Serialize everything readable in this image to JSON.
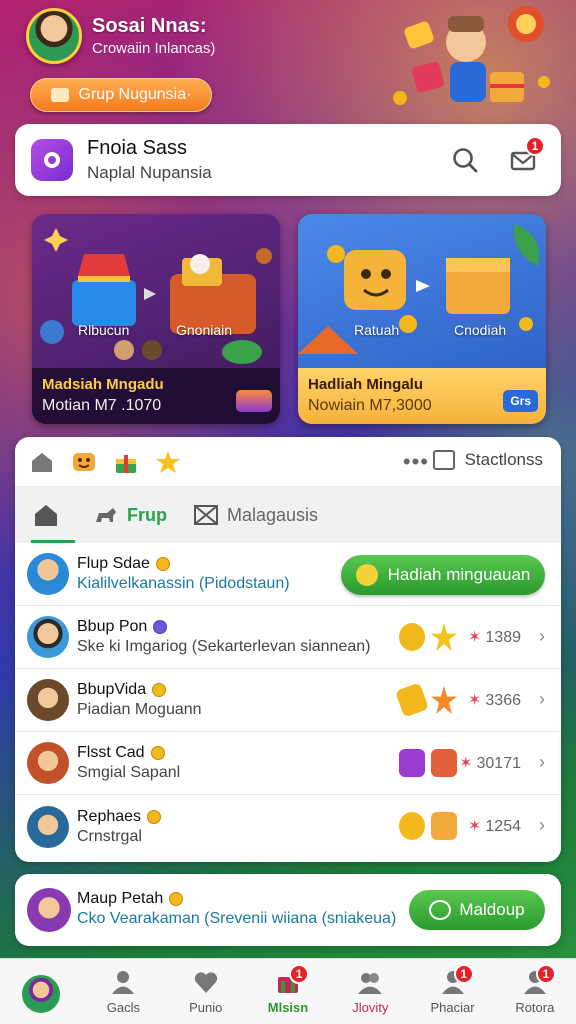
{
  "profile": {
    "name": "Sosai Nnas:",
    "subtitle": "Crowaiin Inlancas)",
    "group_button": "Grup Nugunsia·"
  },
  "search_card": {
    "title": "Fnoia Sass",
    "subtitle": "Naplal Nupansia",
    "mail_badge": "1"
  },
  "promos": [
    {
      "caption_left": "Rlbucun",
      "caption_right": "Gnoniain",
      "title": "Madsiah Mngadu",
      "amount": "Motian M7 .1070",
      "button": ""
    },
    {
      "caption_left": "Ratuah",
      "caption_right": "Cnodiah",
      "title": "Hadliah Mingalu",
      "amount": "Nowiain M7,3000",
      "button": "Grs"
    }
  ],
  "toolbar": {
    "dots": "•••",
    "sections_label": "Stactlonss"
  },
  "tabs": [
    {
      "label": "Frup",
      "active": true
    },
    {
      "label": "Malagausis",
      "active": false
    }
  ],
  "rows": [
    {
      "name": "Flup Sdae",
      "sub": "Kialilvelkanassin (Pidodstaun)",
      "button": "Hadiah minguauan"
    },
    {
      "name": "Bbup Pon",
      "sub": "Ske ki Imgariog (Sekarterlevan siannean)",
      "count": "1389"
    },
    {
      "name": "BbupVida",
      "sub": "Piadian Moguann",
      "count": "3366"
    },
    {
      "name": "Flsst Cad",
      "sub": "Smgial Sapanl",
      "count": "30171"
    },
    {
      "name": "Rephaes",
      "sub": "Crnstrgal",
      "count": "1254"
    }
  ],
  "footer_card": {
    "name": "Maup Petah",
    "sub": "Cko Vearakaman (Srevenii wiiana (sniakeua)",
    "button": "Maldoup"
  },
  "nav": [
    {
      "label": "",
      "badge": ""
    },
    {
      "label": "Gacls",
      "badge": ""
    },
    {
      "label": "Punio",
      "badge": ""
    },
    {
      "label": "Mlsisn",
      "badge": "1"
    },
    {
      "label": "Jlovity",
      "badge": ""
    },
    {
      "label": "Phaciar",
      "badge": "1"
    },
    {
      "label": "Rotora",
      "badge": "1"
    }
  ],
  "colors": {
    "accent_green": "#2aa24a",
    "badge_red": "#e8202a",
    "orange": "#f57a1f"
  }
}
